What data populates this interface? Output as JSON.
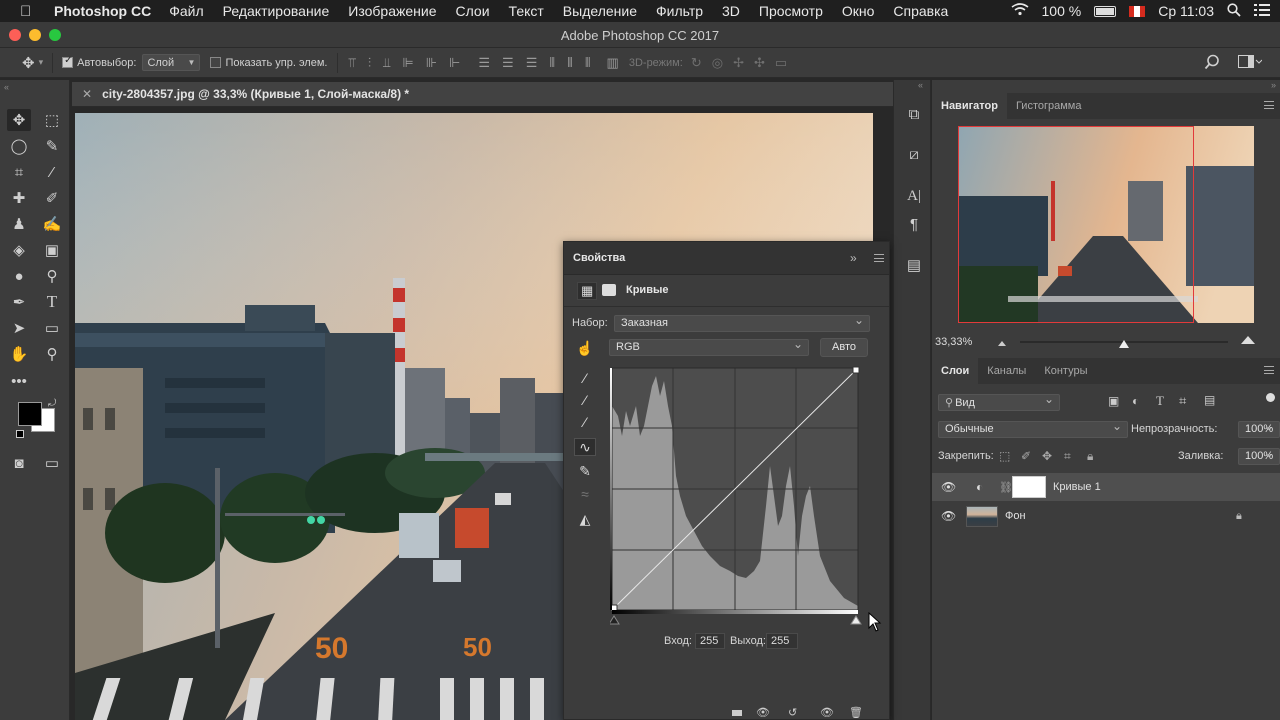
{
  "menubar": {
    "apple_icon": "",
    "app": "Photoshop CC",
    "items": [
      "Файл",
      "Редактирование",
      "Изображение",
      "Слои",
      "Текст",
      "Выделение",
      "Фильтр",
      "3D",
      "Просмотр",
      "Окно",
      "Справка"
    ],
    "battery": "100 %",
    "clock": "Ср 11:03"
  },
  "window": {
    "title": "Adobe Photoshop CC 2017"
  },
  "options": {
    "autoselect_label": "Автовыбор:",
    "autoselect_value": "Слой",
    "show_controls_label": "Показать упр. элем.",
    "mode_3d_label": "3D-режим:"
  },
  "document": {
    "tab_label": "city-2804357.jpg @ 33,3% (Кривые 1, Слой-маска/8) *"
  },
  "navigator": {
    "tabs": [
      "Навигатор",
      "Гистограмма"
    ],
    "zoom": "33,33%",
    "zoom_slider_fraction": 0.5
  },
  "layers": {
    "tabs": [
      "Слои",
      "Каналы",
      "Контуры"
    ],
    "filter_kind": "Вид",
    "blend_mode": "Обычные",
    "opacity_label": "Непрозрачность:",
    "opacity_value": "100%",
    "lock_label": "Закрепить:",
    "fill_label": "Заливка:",
    "fill_value": "100%",
    "items": [
      {
        "name": "Кривые 1",
        "selected": true
      },
      {
        "name": "Фон",
        "locked": true
      }
    ]
  },
  "properties": {
    "title": "Свойства",
    "adjustment_name": "Кривые",
    "preset_label": "Набор:",
    "preset_value": "Заказная",
    "channel_value": "RGB",
    "auto_button": "Авто",
    "input_label": "Вход:",
    "input_value": "255",
    "output_label": "Выход:",
    "output_value": "255"
  },
  "colors": {
    "foreground": "#000000",
    "background": "#ffffff",
    "accent_red": "#e23a3a"
  }
}
